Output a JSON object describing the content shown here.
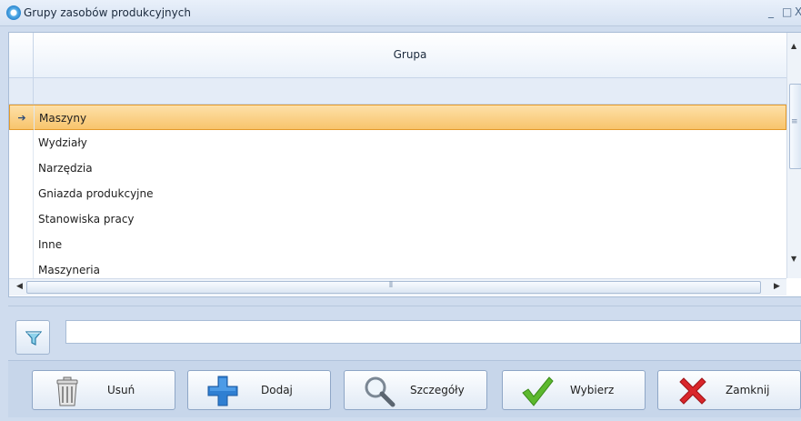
{
  "window": {
    "title": "Grupy zasobów produkcyjnych",
    "minimize": "_",
    "maximize": "□",
    "close": "X"
  },
  "grid": {
    "column_header": "Grupa",
    "current_row_marker": "➔",
    "rows": [
      "Maszyny",
      "Wydziały",
      "Narzędzia",
      "Gniazda produkcyjne",
      "Stanowiska pracy",
      "Inne",
      "Maszyneria"
    ],
    "selected_row": "Maszyny"
  },
  "filter": {
    "value": "",
    "icon": "funnel-icon"
  },
  "buttons": {
    "usun": {
      "label": "Usuń",
      "icon": "trash-icon"
    },
    "dodaj": {
      "label": "Dodaj",
      "icon": "plus-icon"
    },
    "szczegoly": {
      "label": "Szczegóły",
      "icon": "magnifier-icon"
    },
    "wybierz": {
      "label": "Wybierz",
      "icon": "checkmark-icon"
    },
    "zamknij": {
      "label": "Zamknij",
      "icon": "x-icon"
    }
  },
  "colors": {
    "selection": "#f8c46c",
    "selection_border": "#e39a2b",
    "accent_blue": "#2a86cf"
  }
}
